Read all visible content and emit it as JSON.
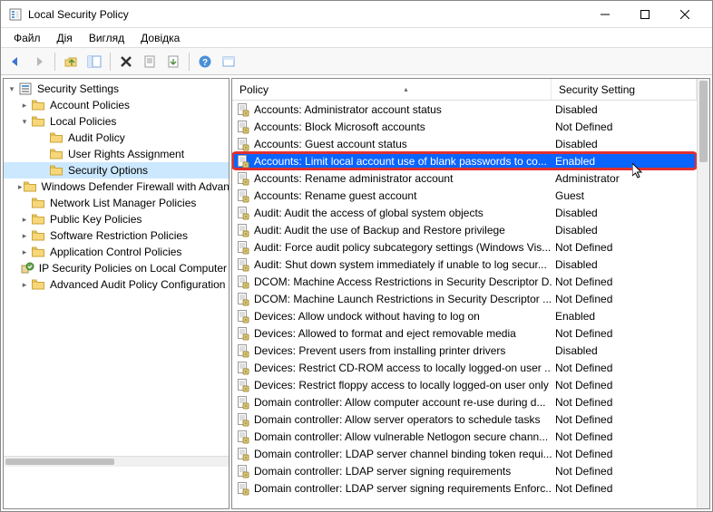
{
  "window": {
    "title": "Local Security Policy"
  },
  "menus": [
    "Файл",
    "Дія",
    "Вигляд",
    "Довідка"
  ],
  "columns": {
    "policy": "Policy",
    "setting": "Security Setting"
  },
  "tree": {
    "root": {
      "label": "Security Settings",
      "expanded": true
    },
    "items": [
      {
        "label": "Account Policies",
        "depth": 1,
        "expandable": true,
        "expanded": false,
        "icon": "folder"
      },
      {
        "label": "Local Policies",
        "depth": 1,
        "expandable": true,
        "expanded": true,
        "icon": "folder"
      },
      {
        "label": "Audit Policy",
        "depth": 2,
        "expandable": false,
        "icon": "folder"
      },
      {
        "label": "User Rights Assignment",
        "depth": 2,
        "expandable": false,
        "icon": "folder"
      },
      {
        "label": "Security Options",
        "depth": 2,
        "expandable": false,
        "icon": "folder",
        "selected": true
      },
      {
        "label": "Windows Defender Firewall with Advanced Security",
        "depth": 1,
        "expandable": true,
        "expanded": false,
        "icon": "folder"
      },
      {
        "label": "Network List Manager Policies",
        "depth": 1,
        "expandable": false,
        "icon": "folder-net"
      },
      {
        "label": "Public Key Policies",
        "depth": 1,
        "expandable": true,
        "expanded": false,
        "icon": "folder"
      },
      {
        "label": "Software Restriction Policies",
        "depth": 1,
        "expandable": true,
        "expanded": false,
        "icon": "folder"
      },
      {
        "label": "Application Control Policies",
        "depth": 1,
        "expandable": true,
        "expanded": false,
        "icon": "folder"
      },
      {
        "label": "IP Security Policies on Local Computer",
        "depth": 1,
        "expandable": false,
        "icon": "ipsec"
      },
      {
        "label": "Advanced Audit Policy Configuration",
        "depth": 1,
        "expandable": true,
        "expanded": false,
        "icon": "folder"
      }
    ]
  },
  "policies": [
    {
      "name": "Accounts: Administrator account status",
      "value": "Disabled"
    },
    {
      "name": "Accounts: Block Microsoft accounts",
      "value": "Not Defined"
    },
    {
      "name": "Accounts: Guest account status",
      "value": "Disabled"
    },
    {
      "name": "Accounts: Limit local account use of blank passwords to co...",
      "value": "Enabled",
      "selected": true,
      "highlighted": true
    },
    {
      "name": "Accounts: Rename administrator account",
      "value": "Administrator"
    },
    {
      "name": "Accounts: Rename guest account",
      "value": "Guest"
    },
    {
      "name": "Audit: Audit the access of global system objects",
      "value": "Disabled"
    },
    {
      "name": "Audit: Audit the use of Backup and Restore privilege",
      "value": "Disabled"
    },
    {
      "name": "Audit: Force audit policy subcategory settings (Windows Vis...",
      "value": "Not Defined"
    },
    {
      "name": "Audit: Shut down system immediately if unable to log secur...",
      "value": "Disabled"
    },
    {
      "name": "DCOM: Machine Access Restrictions in Security Descriptor D...",
      "value": "Not Defined"
    },
    {
      "name": "DCOM: Machine Launch Restrictions in Security Descriptor ...",
      "value": "Not Defined"
    },
    {
      "name": "Devices: Allow undock without having to log on",
      "value": "Enabled"
    },
    {
      "name": "Devices: Allowed to format and eject removable media",
      "value": "Not Defined"
    },
    {
      "name": "Devices: Prevent users from installing printer drivers",
      "value": "Disabled"
    },
    {
      "name": "Devices: Restrict CD-ROM access to locally logged-on user ...",
      "value": "Not Defined"
    },
    {
      "name": "Devices: Restrict floppy access to locally logged-on user only",
      "value": "Not Defined"
    },
    {
      "name": "Domain controller: Allow computer account re-use during d...",
      "value": "Not Defined"
    },
    {
      "name": "Domain controller: Allow server operators to schedule tasks",
      "value": "Not Defined"
    },
    {
      "name": "Domain controller: Allow vulnerable Netlogon secure chann...",
      "value": "Not Defined"
    },
    {
      "name": "Domain controller: LDAP server channel binding token requi...",
      "value": "Not Defined"
    },
    {
      "name": "Domain controller: LDAP server signing requirements",
      "value": "Not Defined"
    },
    {
      "name": "Domain controller: LDAP server signing requirements Enforc...",
      "value": "Not Defined"
    }
  ]
}
